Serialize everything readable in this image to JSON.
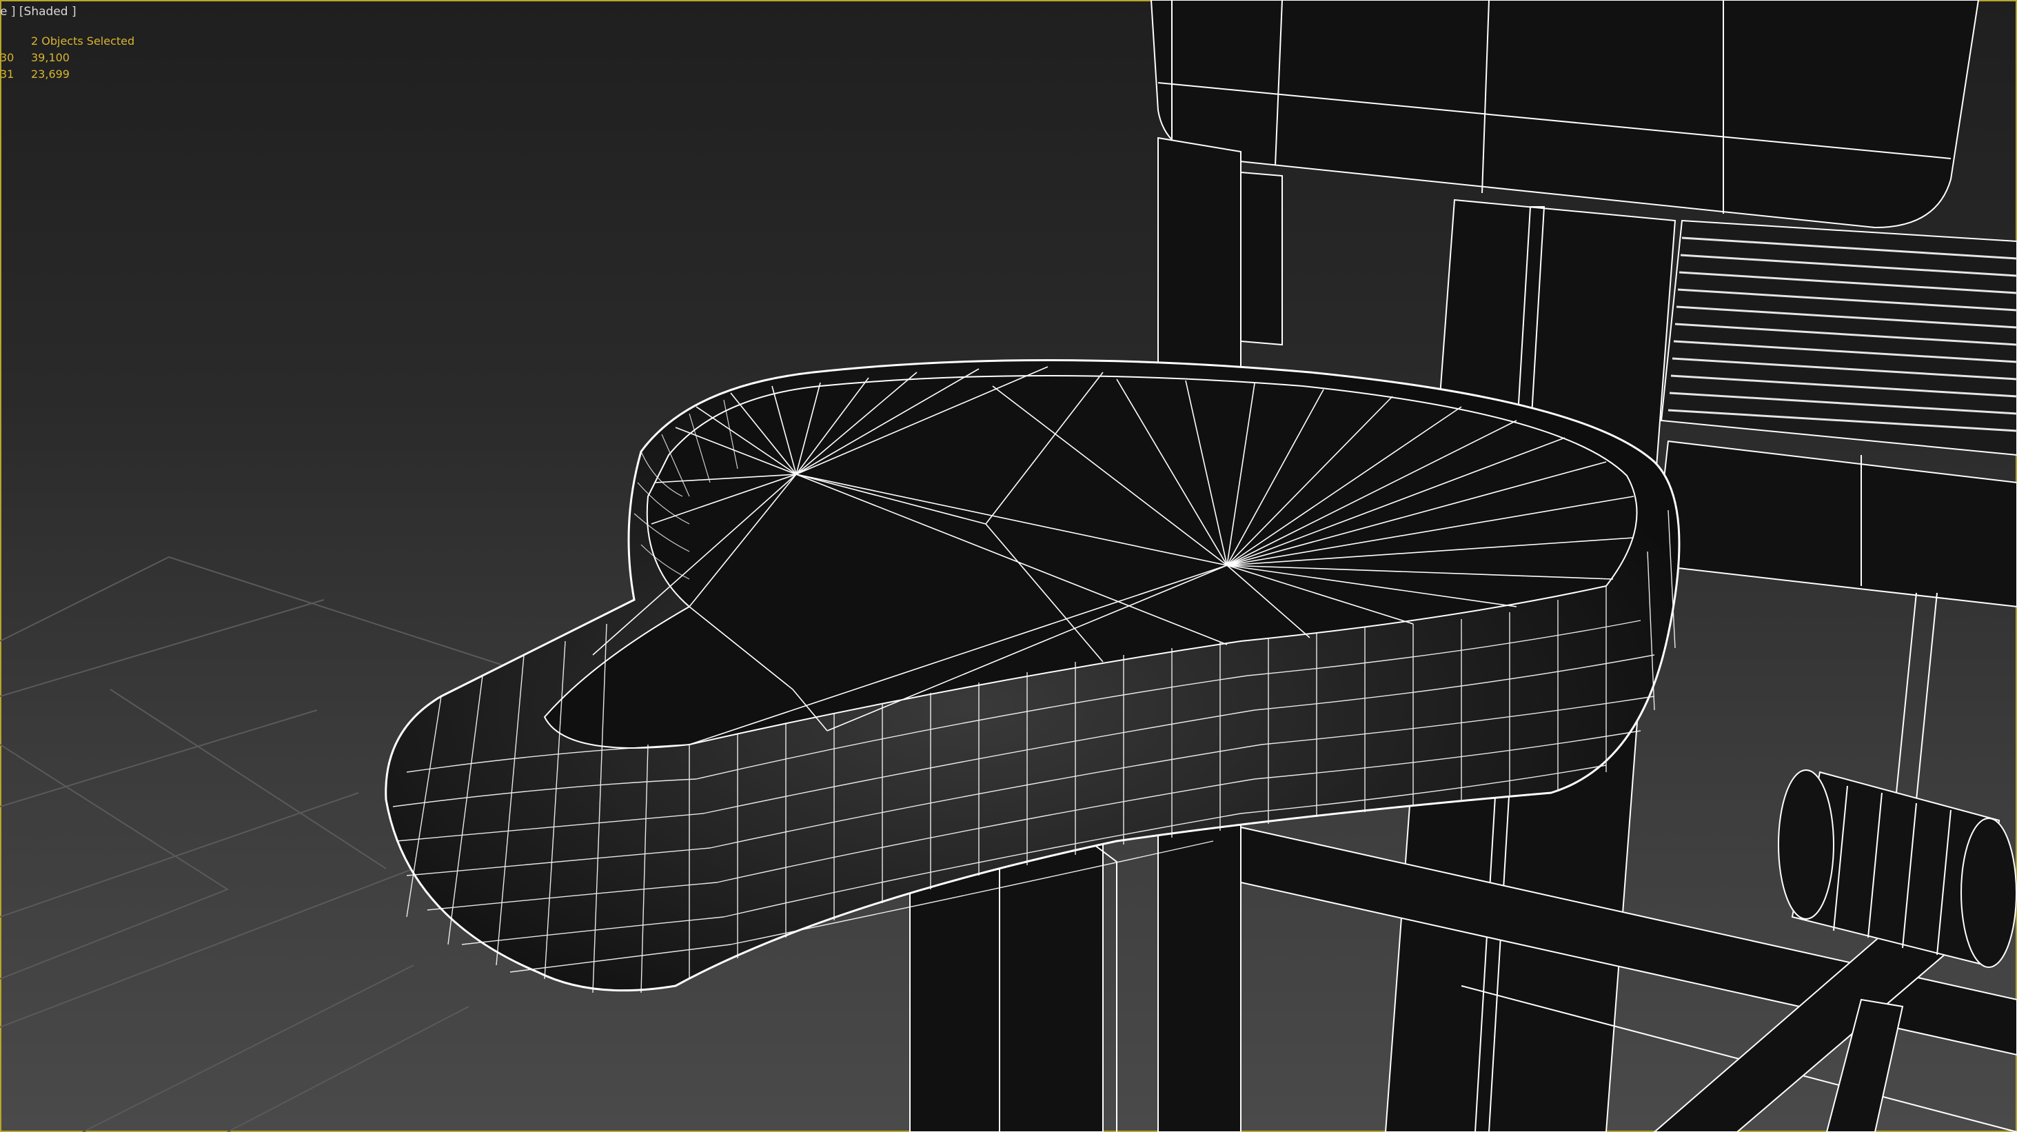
{
  "viewport": {
    "label_view": "e ]",
    "label_shading": "[Shaded ]",
    "stats": {
      "selection_label": "2 Objects Selected",
      "rows": [
        {
          "key": "30",
          "value": "39,100"
        },
        {
          "key": "31",
          "value": "23,699"
        }
      ]
    }
  },
  "colors": {
    "stats_text": "#d8b531",
    "viewport_border": "#b9a52a",
    "wire": "#ffffff",
    "mesh_fill": "#111111"
  }
}
